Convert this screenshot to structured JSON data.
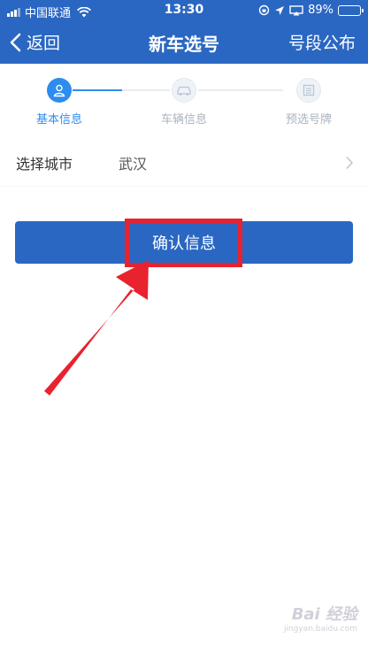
{
  "status_bar": {
    "carrier": "中国联通",
    "time": "13:30",
    "battery": "89%"
  },
  "navbar": {
    "back_label": "返回",
    "title": "新车选号",
    "right_label": "号段公布"
  },
  "steps": [
    {
      "label": "基本信息",
      "state": "active",
      "icon": "user-icon"
    },
    {
      "label": "车辆信息",
      "state": "inactive",
      "icon": "car-icon"
    },
    {
      "label": "预选号牌",
      "state": "inactive",
      "icon": "plate-icon"
    }
  ],
  "form": {
    "city_label": "选择城市",
    "city_value": "武汉"
  },
  "confirm_label": "确认信息",
  "watermark": {
    "brand": "Bai 经验",
    "site": "jingyan.baidu.com"
  },
  "colors": {
    "header_blue": "#2a67c2",
    "accent_blue": "#2d8cf0",
    "annotation_red": "#e8222e"
  }
}
